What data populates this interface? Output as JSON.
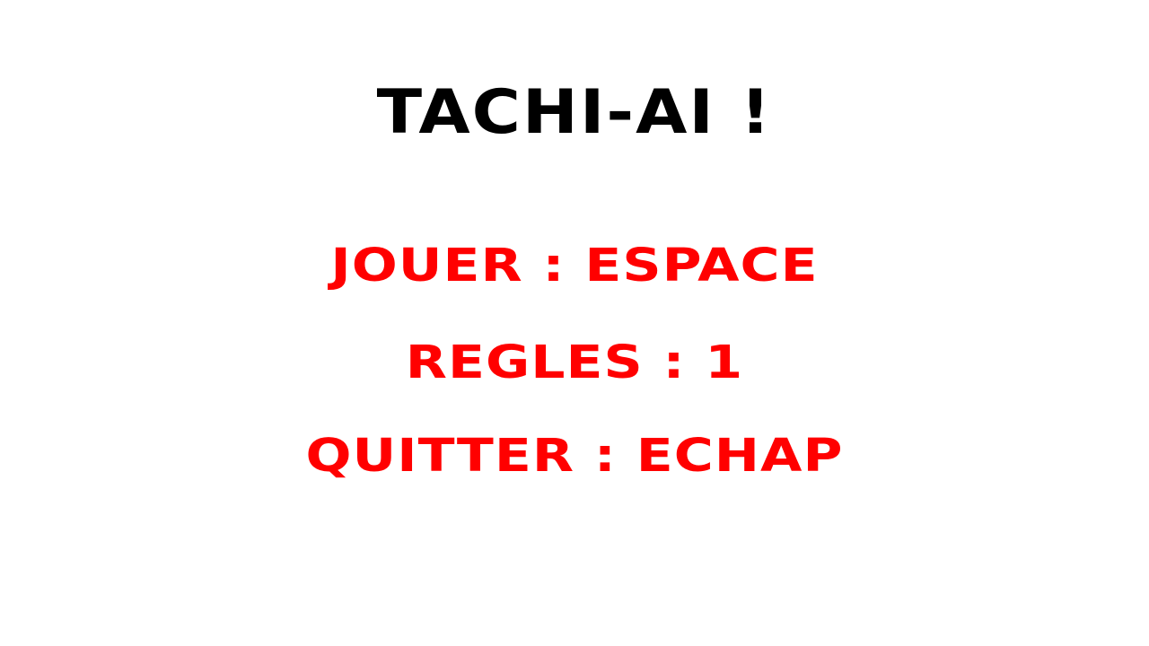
{
  "title": "TACHI-AI !",
  "menu": {
    "items": [
      {
        "label": "JOUER : ESPACE"
      },
      {
        "label": "REGLES : 1"
      },
      {
        "label": "QUITTER : ECHAP"
      }
    ]
  },
  "colors": {
    "background": "#ffffff",
    "title": "#000000",
    "menu": "#ff0000"
  }
}
